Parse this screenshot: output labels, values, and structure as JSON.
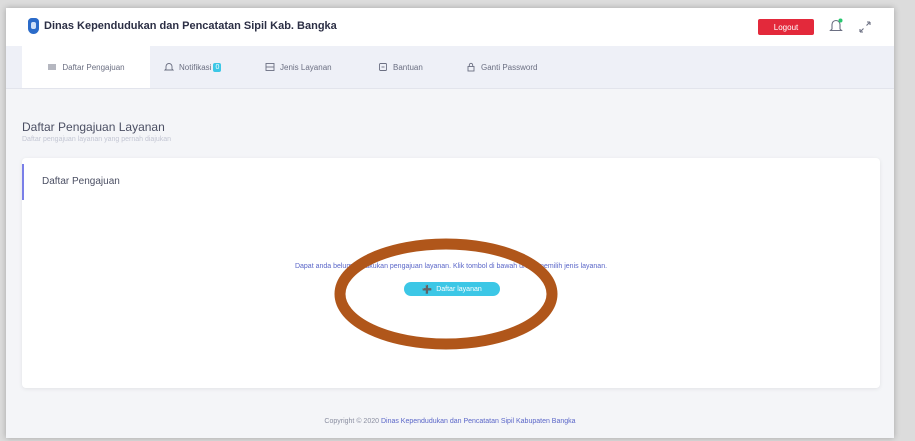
{
  "header": {
    "app_title": "Dinas Kependudukan dan Pencatatan Sipil Kab. Bangka",
    "logout_label": "Logout"
  },
  "nav": {
    "items": [
      {
        "label": "Daftar Pengajuan",
        "icon": "list-icon",
        "active": true
      },
      {
        "label": "Notifikasi",
        "icon": "bell-icon",
        "badge": "0"
      },
      {
        "label": "Jenis Layanan",
        "icon": "grid-icon"
      },
      {
        "label": "Bantuan",
        "icon": "help-icon"
      },
      {
        "label": "Ganti Password",
        "icon": "lock-icon"
      }
    ]
  },
  "page": {
    "title": "Daftar Pengajuan Layanan",
    "subtitle": "Daftar pengajuan layanan yang pernah diajukan"
  },
  "card": {
    "title": "Daftar Pengajuan",
    "empty_message": "Dapat anda belum melakukan pengajuan layanan. Klik tombol di bawah untuk memilih jenis layanan.",
    "button_label": "Daftar layanan"
  },
  "footer": {
    "prefix": "Copyright © 2020",
    "link": "Dinas Kependudukan dan Pencatatan Sipil Kabupaten Bangka"
  },
  "colors": {
    "accent": "#3cc7e6",
    "logout": "#e3293b",
    "annotation": "#b0561a"
  }
}
